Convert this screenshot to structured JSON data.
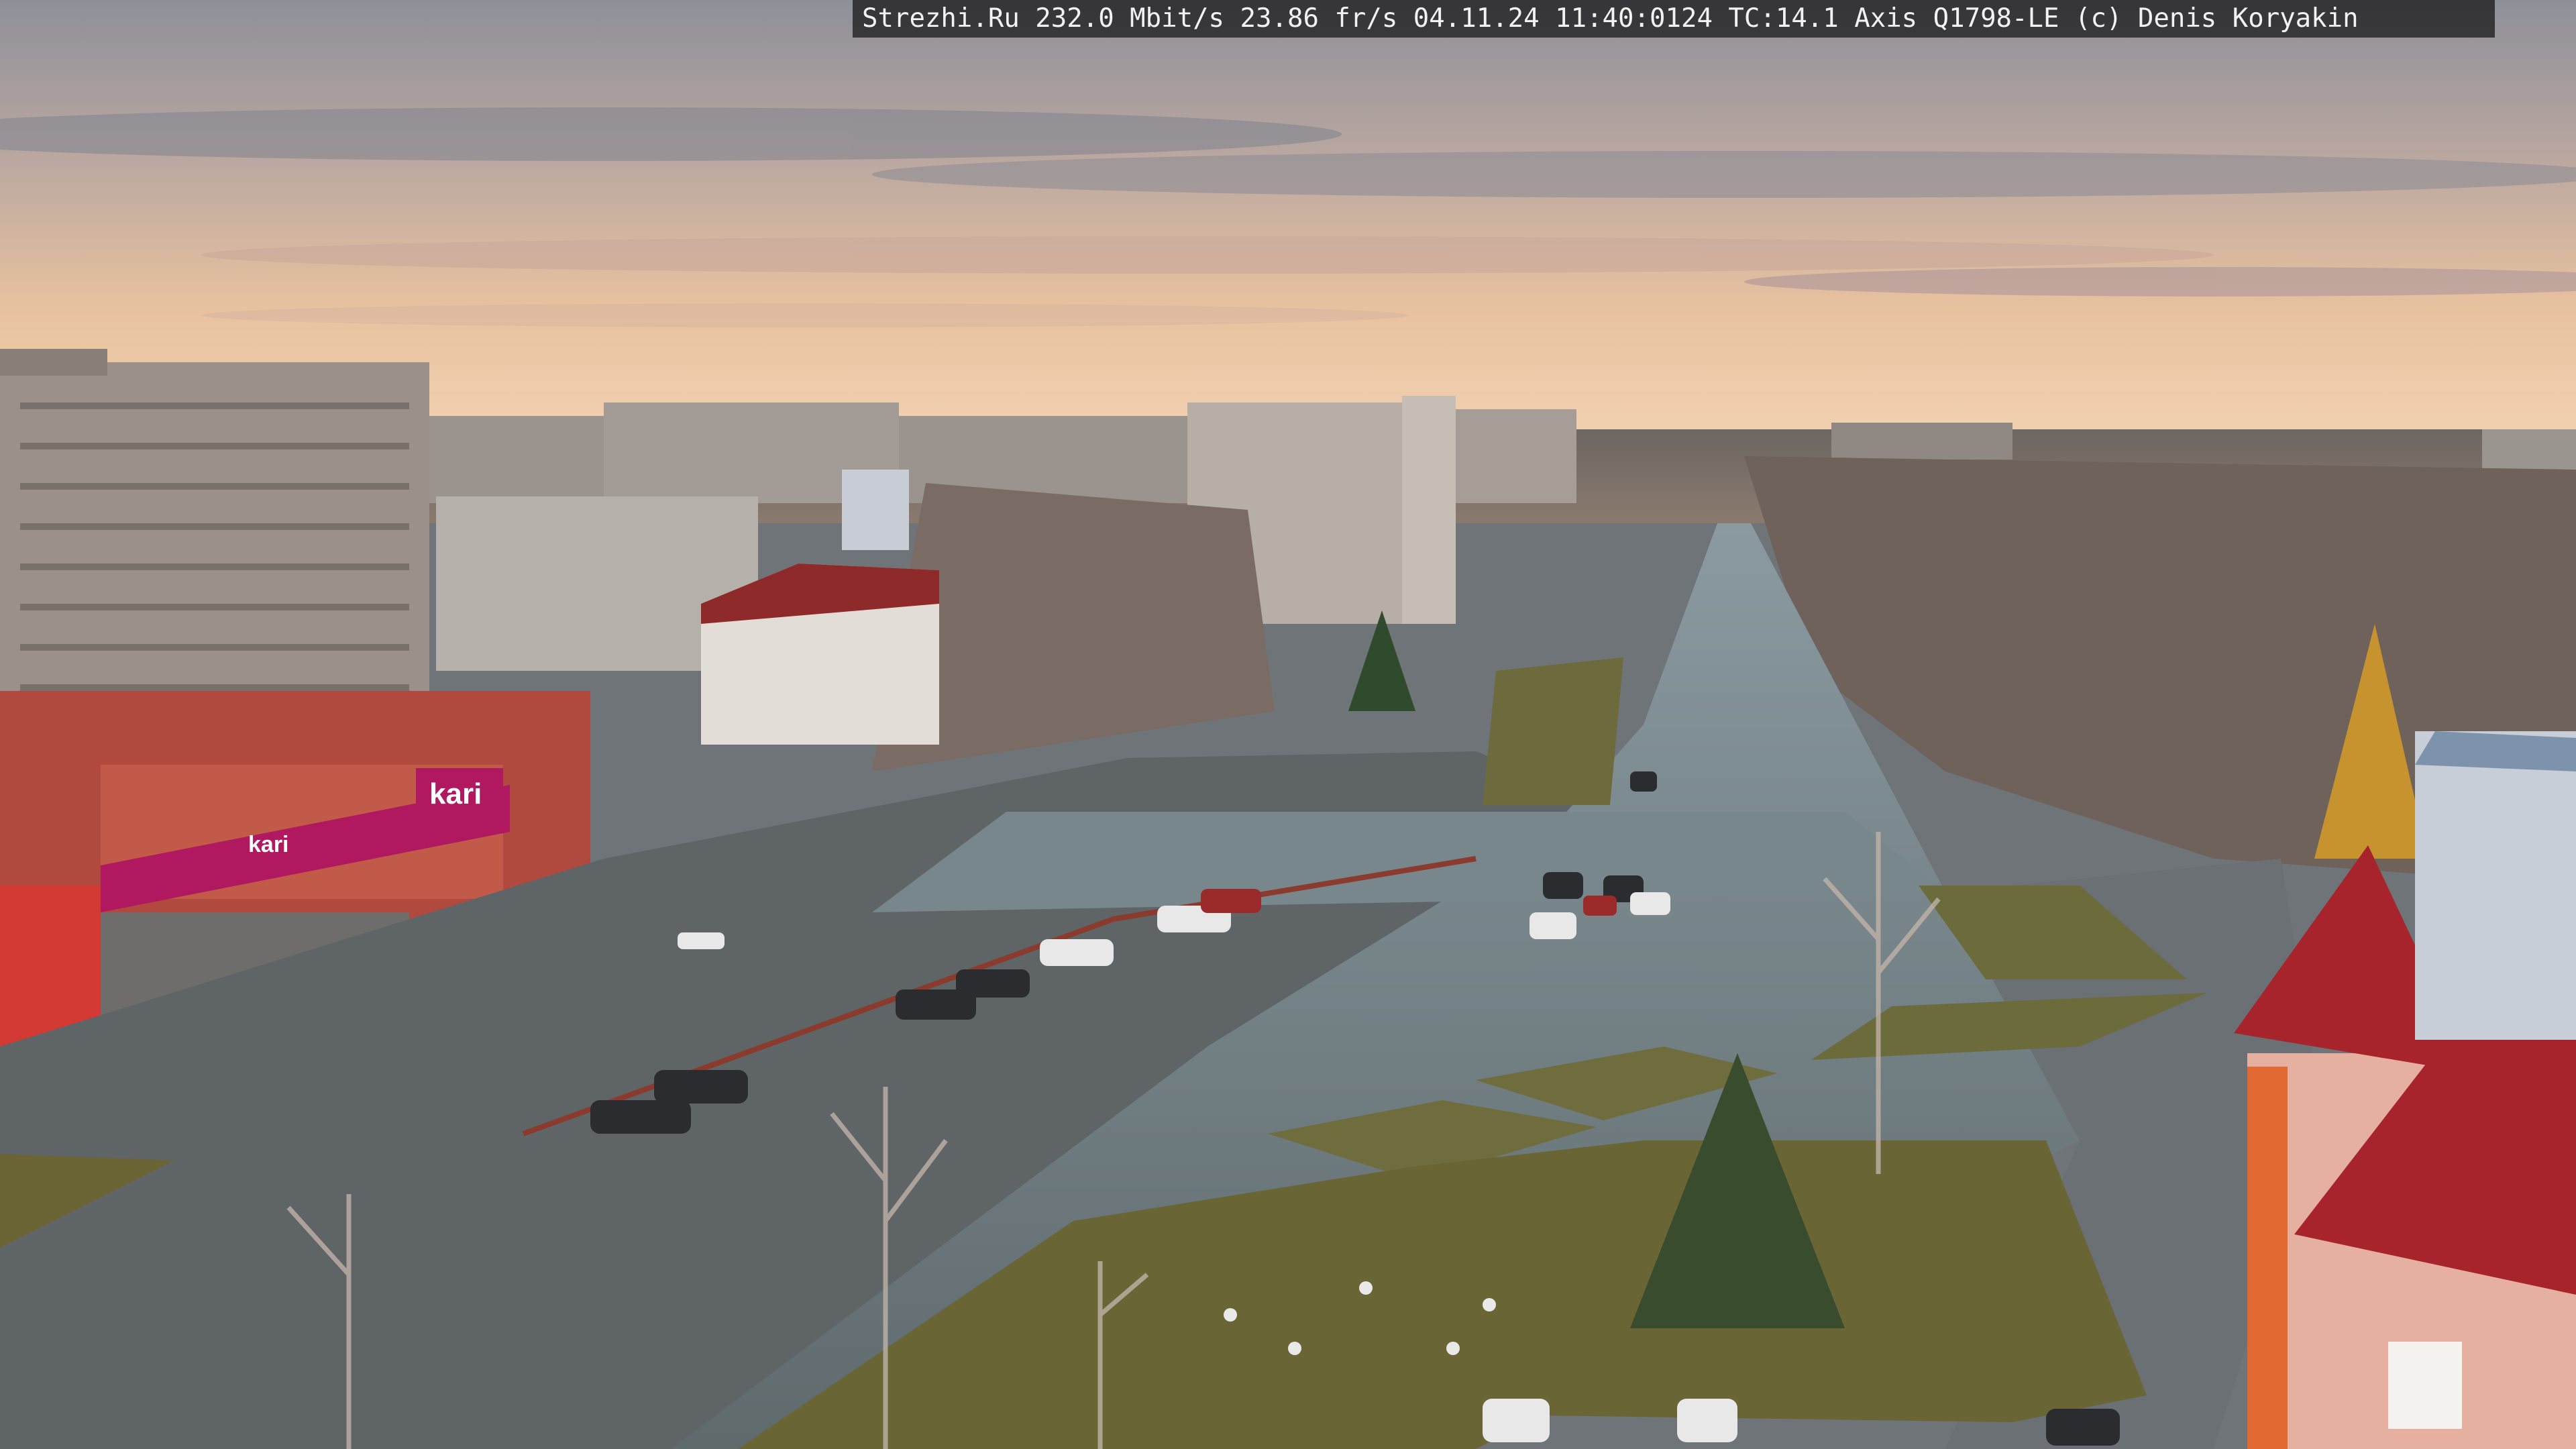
{
  "overlay": {
    "text": "Strezhi.Ru 232.0 Mbit/s 23.86 fr/s 04.11.24 11:40:0124 TC:14.1  Axis Q1798-LE  (c) Denis Koryakin"
  },
  "signs": {
    "store_main": "kari",
    "store_facade": "kari",
    "store_pink": "kari"
  },
  "colors": {
    "sky_top": "#8d8f99",
    "sky_horizon": "#f0c9a4",
    "road": "#6d7a7e",
    "grass": "#6b6a3a",
    "kari_magenta": "#b0185f",
    "red_roof": "#a8242c"
  }
}
